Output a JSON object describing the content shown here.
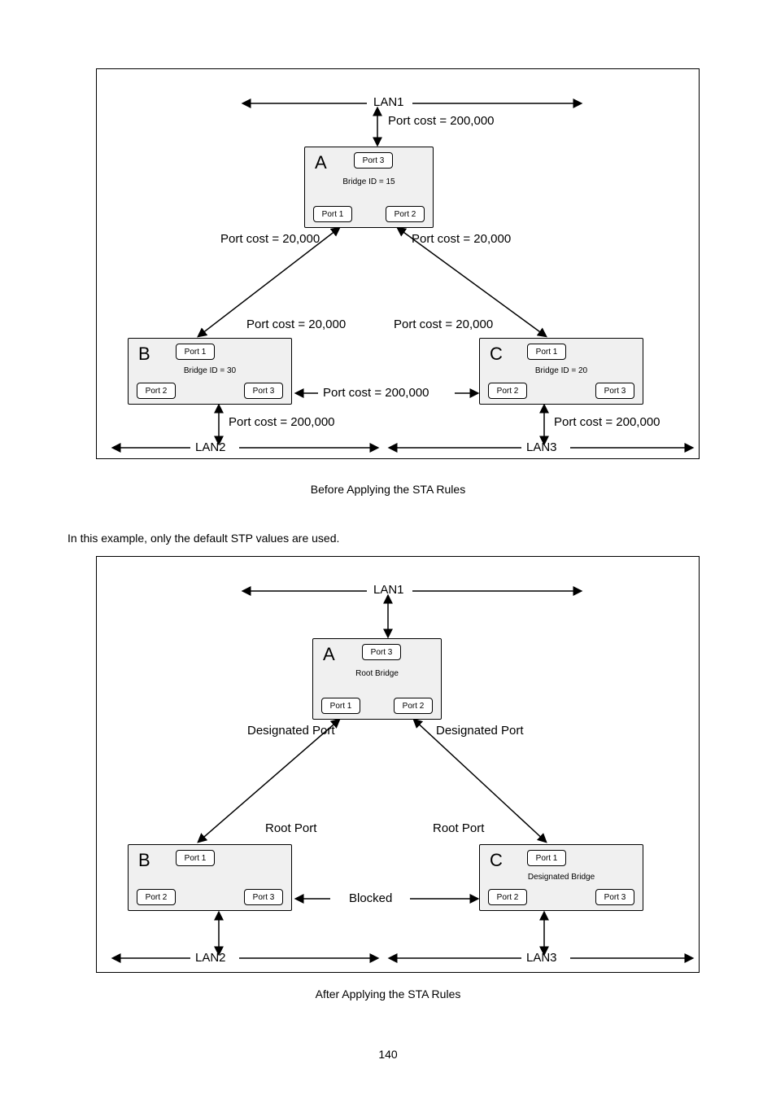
{
  "page_number": "140",
  "body": {
    "paragraph1": "In this example, only the default STP values are used."
  },
  "figure1": {
    "caption": "Before Applying the STA Rules",
    "lan1": "LAN1",
    "lan2": "LAN2",
    "lan3": "LAN3",
    "cost_200k": "Port cost = 200,000",
    "cost_20k": "Port cost = 20,000",
    "nodeA": {
      "letter": "A",
      "port1": "Port 1",
      "port2": "Port 2",
      "port3": "Port 3",
      "sub": "Bridge ID = 15"
    },
    "nodeB": {
      "letter": "B",
      "port1": "Port 1",
      "port2": "Port 2",
      "port3": "Port 3",
      "sub": "Bridge ID = 30"
    },
    "nodeC": {
      "letter": "C",
      "port1": "Port 1",
      "port2": "Port 2",
      "port3": "Port 3",
      "sub": "Bridge ID = 20"
    }
  },
  "figure2": {
    "caption": "After Applying the STA Rules",
    "lan1": "LAN1",
    "lan2": "LAN2",
    "lan3": "LAN3",
    "designated_port": "Designated Port",
    "root_port": "Root Port",
    "blocked": "Blocked",
    "nodeA": {
      "letter": "A",
      "port1": "Port 1",
      "port2": "Port 2",
      "port3": "Port 3",
      "sub": "Root Bridge"
    },
    "nodeB": {
      "letter": "B",
      "port1": "Port 1",
      "port2": "Port 2",
      "port3": "Port 3",
      "sub": " "
    },
    "nodeC": {
      "letter": "C",
      "port1": "Port 1",
      "port2": "Port 2",
      "port3": "Port 3",
      "sub": "Designated Bridge"
    }
  }
}
